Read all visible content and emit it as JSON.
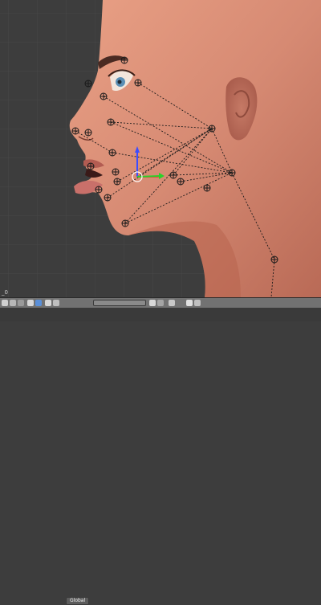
{
  "viewport": {
    "object_label": "_0",
    "background": "#3d3d3d",
    "grid_color": "#484848",
    "skin_color": "#d68a73",
    "bone_color": "#1a1a1a"
  },
  "header": {
    "orientation_label": "Global",
    "icons": [
      "view-icon",
      "select-icon",
      "object-mode-icon",
      "shading-icon",
      "pivot-icon",
      "manipulator-icon",
      "layers-icon",
      "snap-icon",
      "render-icon"
    ]
  }
}
